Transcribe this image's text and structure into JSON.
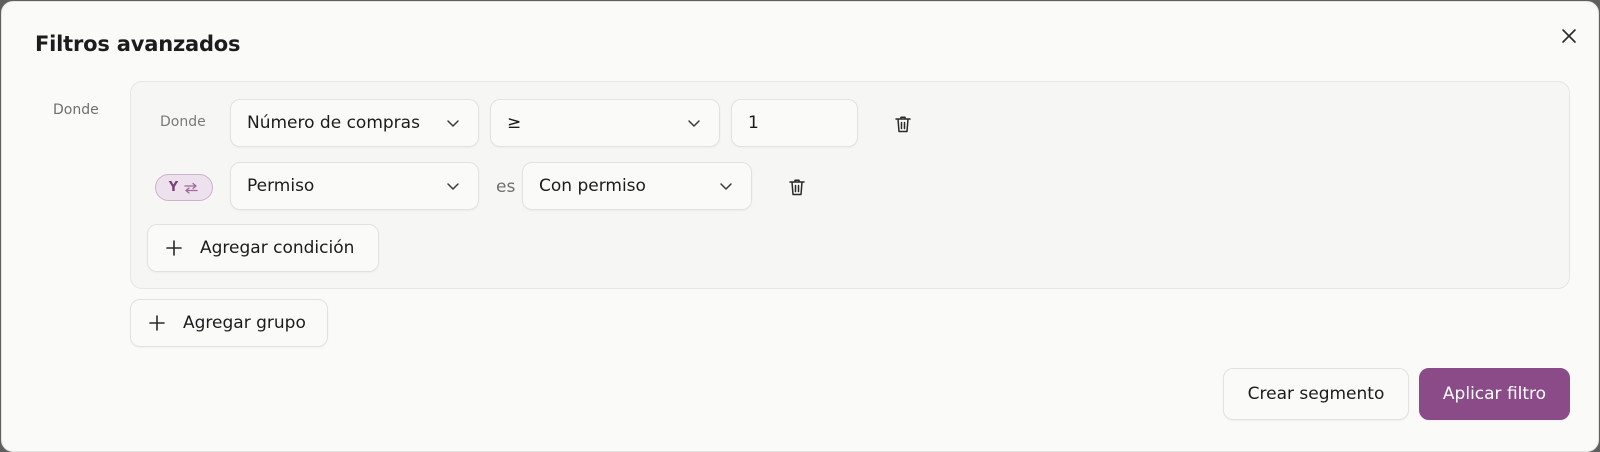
{
  "modal": {
    "title": "Filtros avanzados",
    "close_icon": "close-icon"
  },
  "filters": {
    "where_label": "Donde",
    "group": {
      "conditions": [
        {
          "prefix": "Donde",
          "field": "Número de compras",
          "operator": "≥",
          "value": "1"
        },
        {
          "connector": "Y",
          "connector_icon": "swap-arrows-icon",
          "field": "Permiso",
          "operator_text": "es",
          "value": "Con permiso"
        }
      ],
      "add_condition_label": "Agregar condición"
    },
    "add_group_label": "Agregar grupo"
  },
  "footer": {
    "create_segment_label": "Crear segmento",
    "apply_filter_label": "Aplicar filtro"
  },
  "colors": {
    "primary": "#8a4b88",
    "toggle_bg": "#ece1ec",
    "toggle_text": "#7a3f78"
  }
}
